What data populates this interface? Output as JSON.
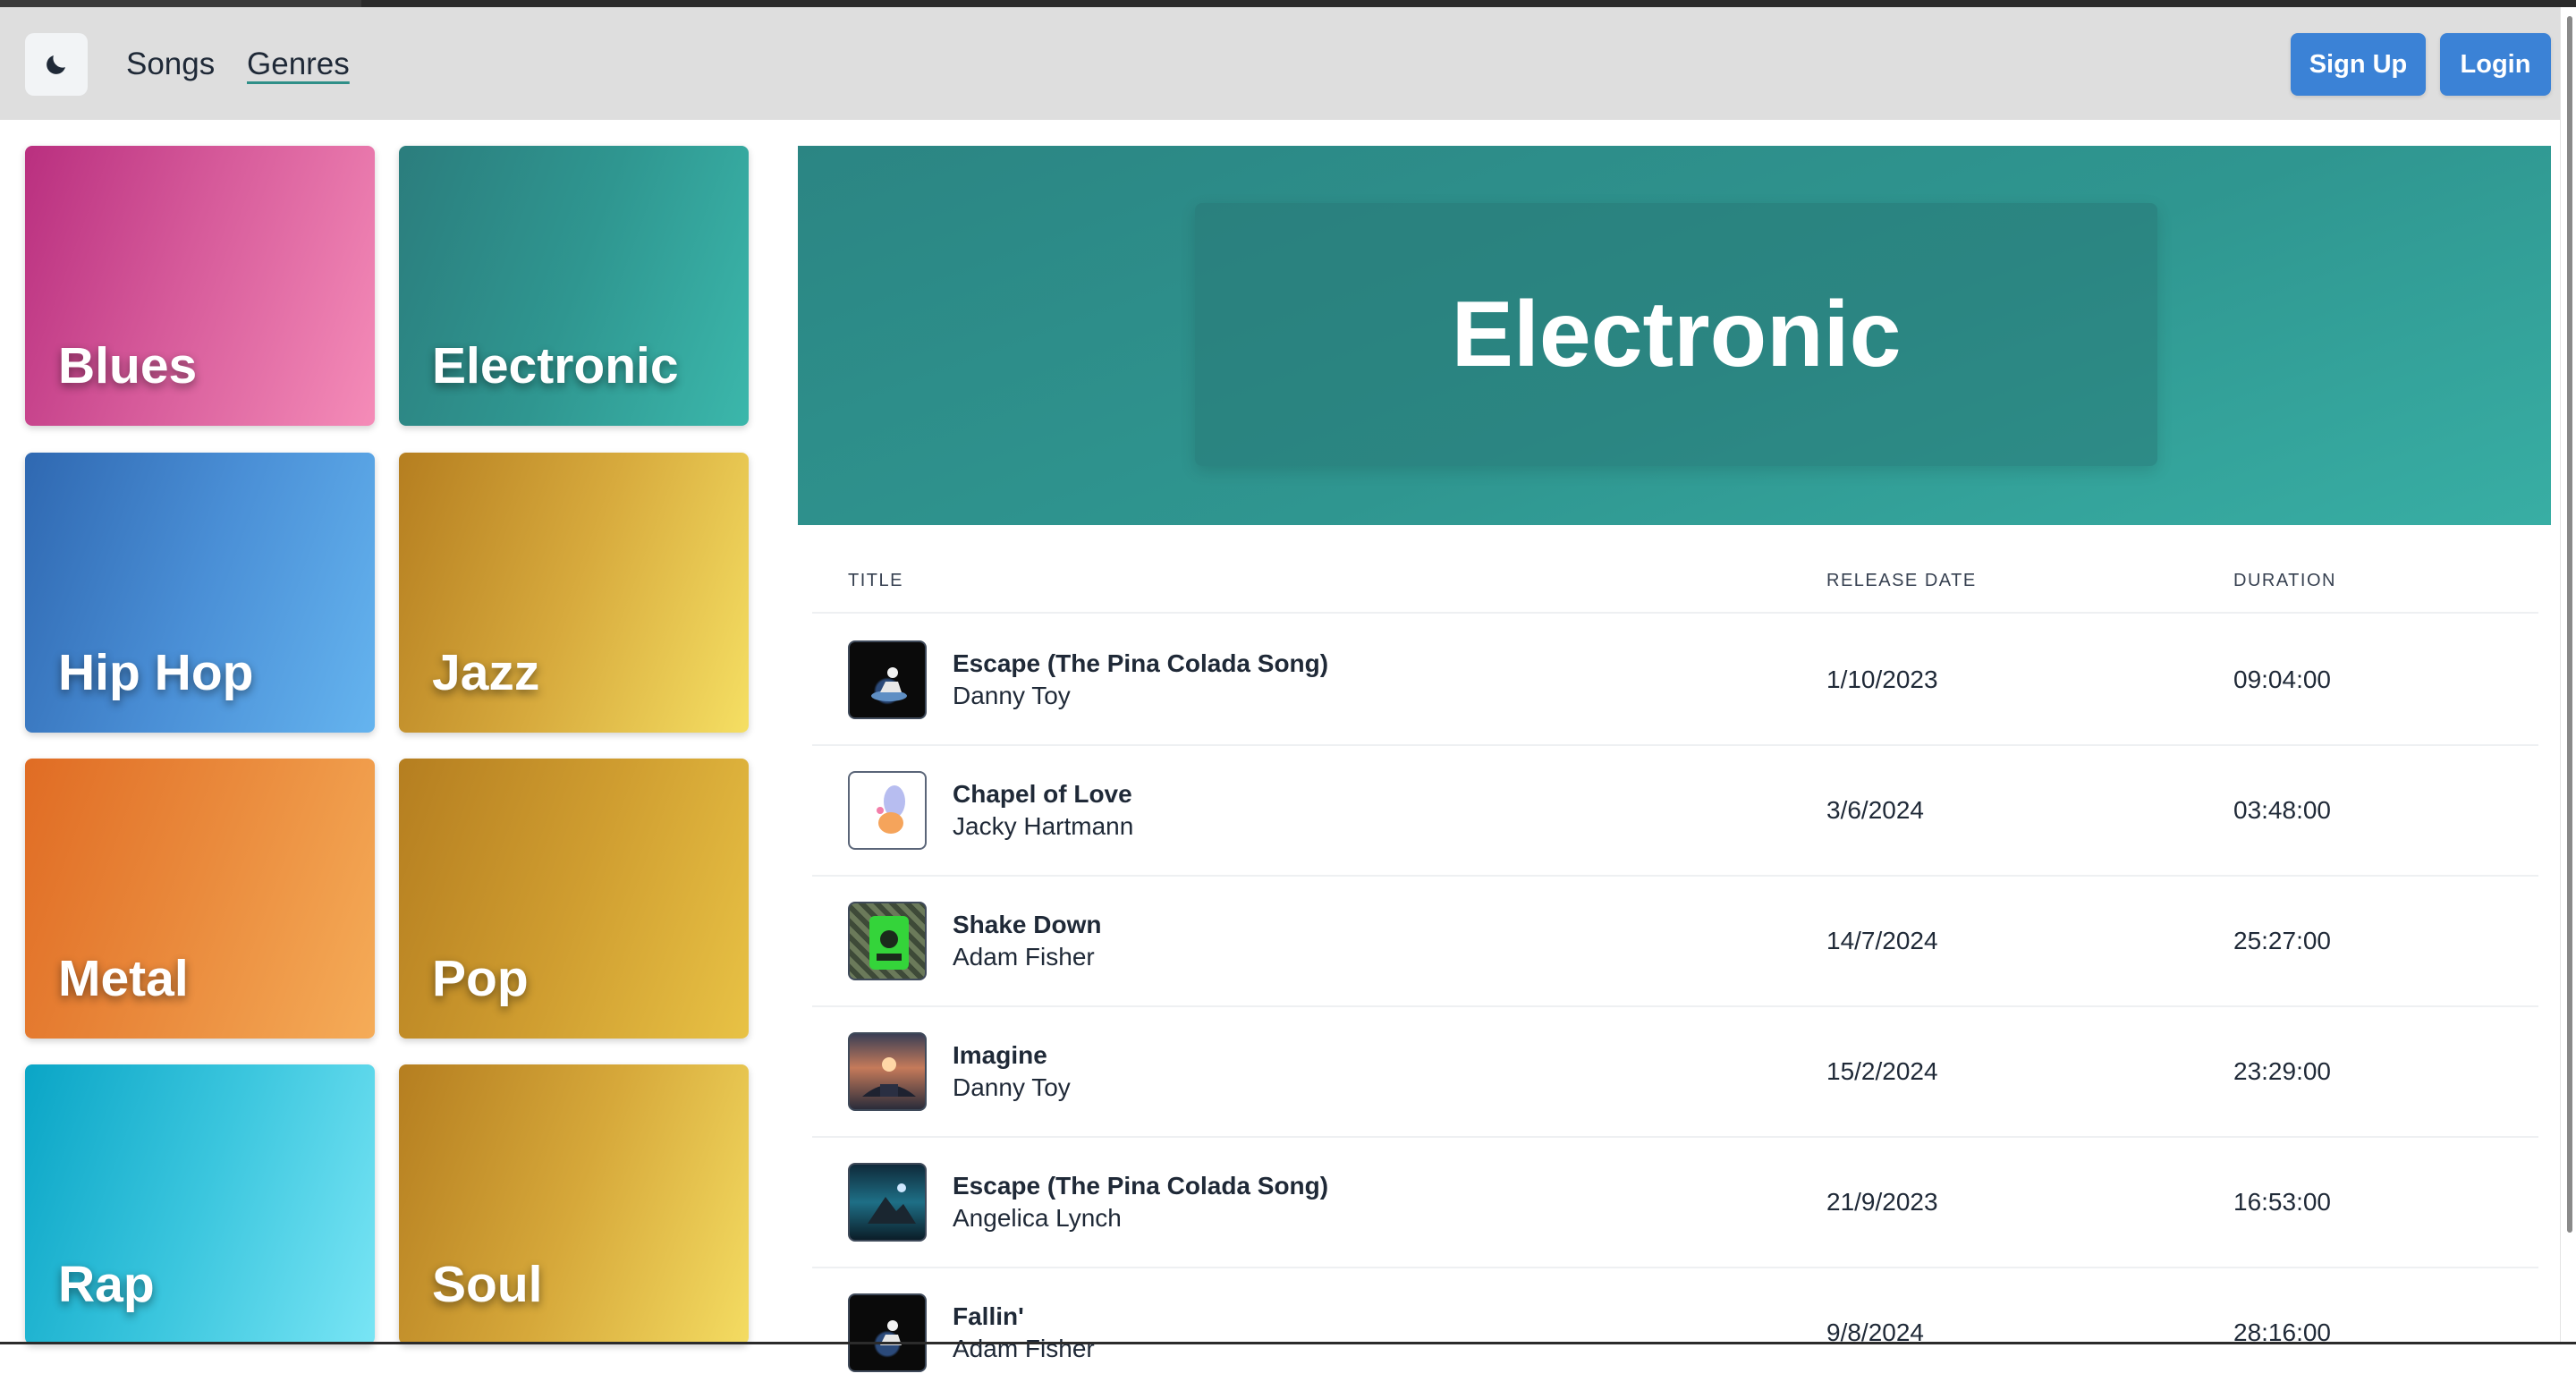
{
  "navbar": {
    "theme_icon": "moon-icon",
    "links": [
      "Songs",
      "Genres"
    ],
    "active_link": "Genres",
    "signup_label": "Sign Up",
    "login_label": "Login",
    "button_color": "#3b82d6"
  },
  "genres": [
    {
      "name": "Blues",
      "color": "#d65a9a"
    },
    {
      "name": "Electronic",
      "color": "#2f9690"
    },
    {
      "name": "Hip Hop",
      "color": "#4a8fd6"
    },
    {
      "name": "Jazz",
      "color": "#d7aa3d"
    },
    {
      "name": "Metal",
      "color": "#ea8b3d"
    },
    {
      "name": "Pop",
      "color": "#cf9d30"
    },
    {
      "name": "Rap",
      "color": "#3bc6de"
    },
    {
      "name": "Soul",
      "color": "#d6a83a"
    }
  ],
  "hero": {
    "title": "Electronic",
    "color": "#2f9690"
  },
  "table": {
    "headers": {
      "title": "TITLE",
      "release_date": "RELEASE DATE",
      "duration": "DURATION"
    },
    "rows": [
      {
        "title": "Escape (The Pina Colada Song)",
        "artist": "Danny Toy",
        "release_date": "1/10/2023",
        "duration": "09:04:00",
        "cover_icon": "album-cover-image"
      },
      {
        "title": "Chapel of Love",
        "artist": "Jacky Hartmann",
        "release_date": "3/6/2024",
        "duration": "03:48:00",
        "cover_icon": "album-cover-image"
      },
      {
        "title": "Shake Down",
        "artist": "Adam Fisher",
        "release_date": "14/7/2024",
        "duration": "25:27:00",
        "cover_icon": "album-cover-image"
      },
      {
        "title": "Imagine",
        "artist": "Danny Toy",
        "release_date": "15/2/2024",
        "duration": "23:29:00",
        "cover_icon": "album-cover-image"
      },
      {
        "title": "Escape (The Pina Colada Song)",
        "artist": "Angelica Lynch",
        "release_date": "21/9/2023",
        "duration": "16:53:00",
        "cover_icon": "album-cover-image"
      },
      {
        "title": "Fallin'",
        "artist": "Adam Fisher",
        "release_date": "9/8/2024",
        "duration": "28:16:00",
        "cover_icon": "album-cover-image"
      }
    ]
  }
}
